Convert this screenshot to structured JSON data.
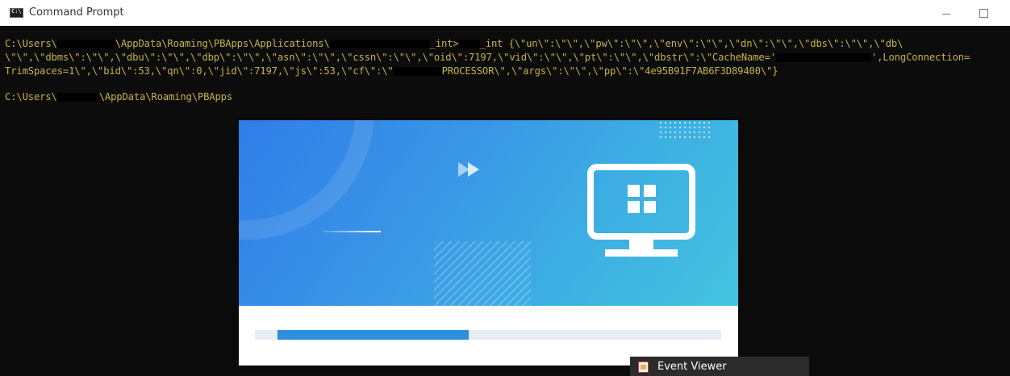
{
  "window": {
    "title": "Command Prompt",
    "icon": "cmd-icon",
    "controls": [
      "minimize-icon",
      "maximize-icon"
    ]
  },
  "console": {
    "text_color": "#c6b24a",
    "background": "#0c0c0c",
    "line1": {
      "a": "C:\\Users\\",
      "b": "\\AppData\\Roaming\\PBApps\\Applications\\",
      "c": "_int>",
      "d": "_int {\\\"un\\\":\\\"\\\",\\\"pw\\\":\\\"\\\",\\\"env\\\":\\\"\\\",\\\"dn\\\":\\\"\\\",\\\"dbs\\\":\\\"\\\",\\\"db\\"
    },
    "line2": {
      "a": "\\\"\\\",\\\"dbms\\\":\\\"\\\",\\\"dbu\\\":\\\"\\\",\\\"dbp\\\":\\\"\\\",\\\"asn\\\":\\\"\\\",\\\"cssn\\\":\\\"\\\",\\\"oid\\\":7197,\\\"vid\\\":\\\"\\\",\\\"pt\\\":\\\"\\\",\\\"dbstr\\\":\\\"CacheName='",
      "b": "',LongConnection="
    },
    "line3": {
      "a": "TrimSpaces=1\\\",\\\"bid\\\":53,\\\"qn\\\":0,\\\"jid\\\":7197,\\\"js\\\":53,\\\"cf\\\":\\\"",
      "b": "PROCESSOR\\\",\\\"args\\\":\\\"\\\",\\\"pp\\\":\\\"4e95B91F7AB6F3D89400\\\"}"
    },
    "line4": {
      "a": "C:\\Users\\",
      "b": "\\AppData\\Roaming\\PBApps"
    }
  },
  "splash": {
    "progress": 0.43,
    "accent": "#2e8ee0",
    "gradient": [
      "#2f7de8",
      "#45c3df"
    ],
    "icons": [
      "fast-forward-icon",
      "monitor-app-icon"
    ]
  },
  "taskbar_popup": {
    "label": "Event Viewer",
    "icon": "event-viewer-icon"
  }
}
